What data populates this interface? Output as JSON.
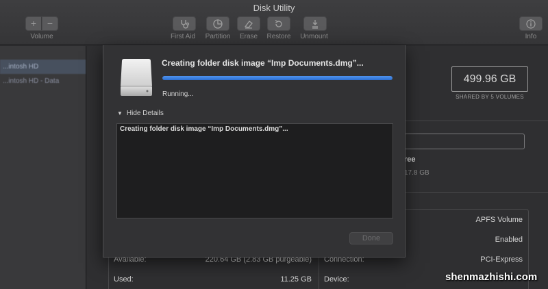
{
  "window": {
    "title": "Disk Utility"
  },
  "toolbar": {
    "volume_label": "Volume",
    "add_symbol": "+",
    "remove_symbol": "−",
    "first_aid_label": "First Aid",
    "partition_label": "Partition",
    "erase_label": "Erase",
    "restore_label": "Restore",
    "unmount_label": "Unmount",
    "info_label": "Info"
  },
  "sidebar": {
    "items": [
      {
        "label": "...intosh HD"
      },
      {
        "label": "...intosh HD - Data"
      }
    ]
  },
  "background": {
    "capacity": "499.96 GB",
    "capacity_sub": "SHARED BY 5 VOLUMES",
    "free_label_partial": "ree",
    "free_value_partial": "17.8 GB",
    "info_rows": {
      "type_value": "APFS Volume",
      "owners_value": "Enabled",
      "available_label": "Available:",
      "available_value": "220.64 GB (2.83 GB purgeable)",
      "connection_label": "Connection:",
      "connection_value": "PCI-Express",
      "used_label": "Used:",
      "used_value": "11.25 GB",
      "device_label": "Device:"
    }
  },
  "dialog": {
    "title": "Creating folder disk image “Imp Documents.dmg”...",
    "status": "Running...",
    "progress": 1.0,
    "details_toggle": "Hide Details",
    "log_text": "Creating folder disk image “Imp Documents.dmg”...",
    "done_label": "Done"
  },
  "watermark": "shenmazhishi.com",
  "colors": {
    "accent": "#3a7de0",
    "background": "#2b2b2d"
  }
}
